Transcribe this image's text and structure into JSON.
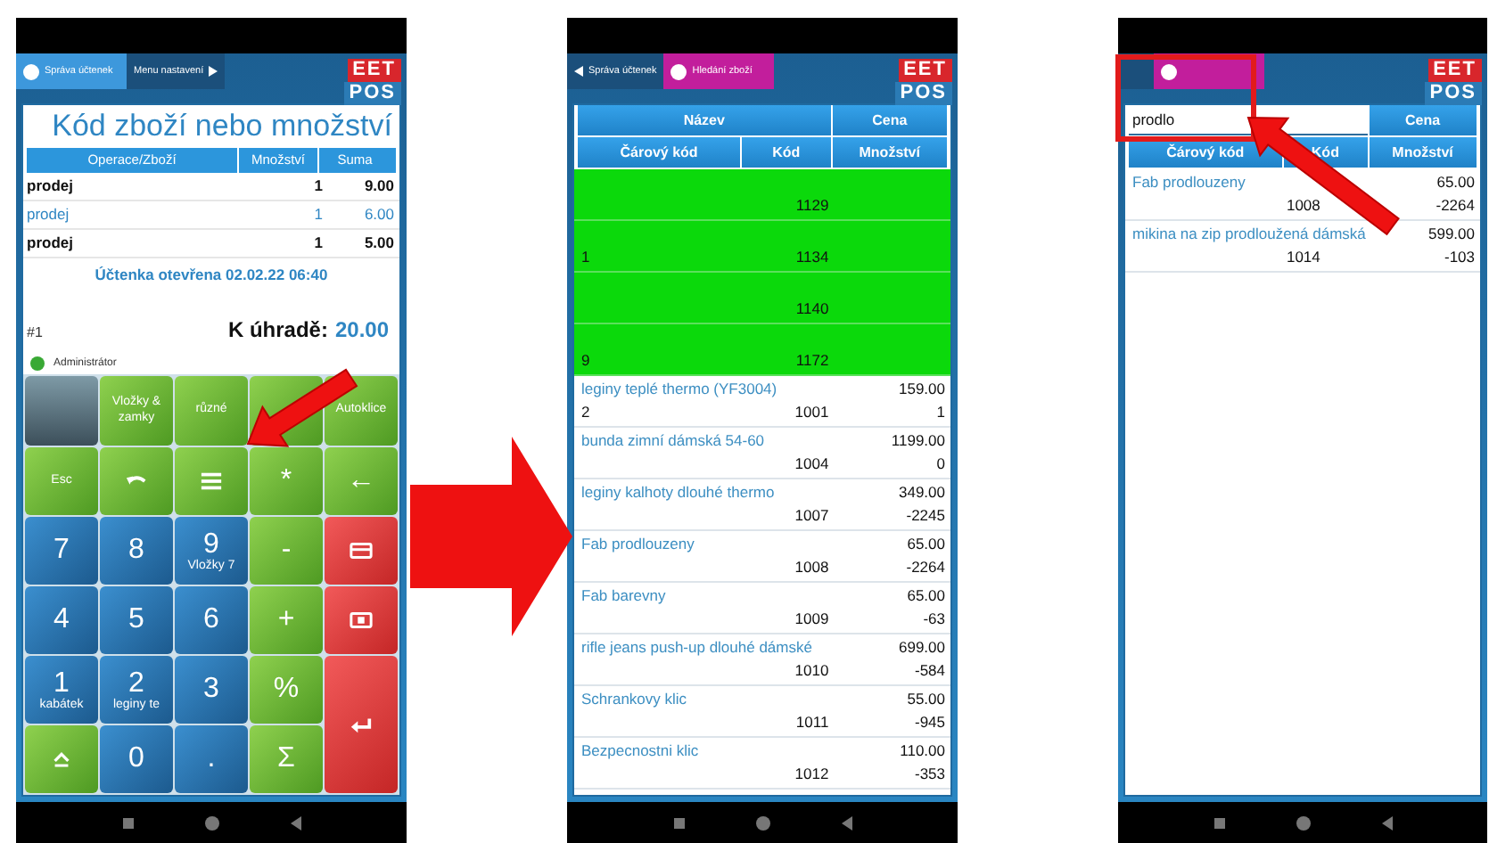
{
  "register_screen": {
    "tabs": [
      {
        "label": "Správa účtenek",
        "selected": true
      },
      {
        "label": "Menu nastavení",
        "selected": false
      }
    ],
    "logo": [
      "EET",
      "POS"
    ],
    "title": "Kód zboží nebo množství",
    "columns": [
      "Operace/Zboží",
      "Množství",
      "Suma"
    ],
    "rows": [
      {
        "operation": "prodej",
        "quantity": "1",
        "sum": "9.00",
        "selected": false
      },
      {
        "operation": "prodej",
        "quantity": "1",
        "sum": "6.00",
        "selected": true
      },
      {
        "operation": "prodej",
        "quantity": "1",
        "sum": "5.00",
        "selected": false
      }
    ],
    "receipt_opened": "Účtenka otevřena 02.02.22 06:40",
    "receipt_number": "#1",
    "due_label": "K úhradě:",
    "due_amount": "20.00",
    "user": "Administrátor",
    "keys": [
      {
        "kind": "photo"
      },
      {
        "kind": "func",
        "label": "Vložky & zamky"
      },
      {
        "kind": "func",
        "label": "různé"
      },
      {
        "kind": "func"
      },
      {
        "kind": "func",
        "label": "Autoklice"
      },
      {
        "kind": "func",
        "label": "Esc"
      },
      {
        "kind": "undo"
      },
      {
        "kind": "list"
      },
      {
        "kind": "func",
        "label": "*"
      },
      {
        "kind": "func",
        "label": "←"
      },
      {
        "kind": "digit",
        "label": "7"
      },
      {
        "kind": "digit",
        "label": "8"
      },
      {
        "kind": "digit",
        "label": "9",
        "sub": "Vložky 7"
      },
      {
        "kind": "func",
        "label": "-"
      },
      {
        "kind": "card"
      },
      {
        "kind": "digit",
        "label": "4"
      },
      {
        "kind": "digit",
        "label": "5"
      },
      {
        "kind": "digit",
        "label": "6"
      },
      {
        "kind": "func",
        "label": "+"
      },
      {
        "kind": "cash"
      },
      {
        "kind": "digit",
        "label": "1",
        "sub": "kabátek"
      },
      {
        "kind": "digit",
        "label": "2",
        "sub": "leginy te"
      },
      {
        "kind": "digit",
        "label": "3"
      },
      {
        "kind": "func",
        "label": "%"
      },
      {
        "kind": "enter"
      },
      {
        "kind": "shift"
      },
      {
        "kind": "digit",
        "label": "0"
      },
      {
        "kind": "digit",
        "label": "."
      },
      {
        "kind": "func",
        "label": "Σ"
      }
    ]
  },
  "product_list_screen": {
    "tabs": [
      {
        "label": "Správa účtenek",
        "selected": false
      },
      {
        "label": "Hledání zboží",
        "selected": true
      }
    ],
    "logo": [
      "EET",
      "POS"
    ],
    "header_top": [
      "Název",
      "Cena"
    ],
    "header_bottom": [
      "Čárový kód",
      "Kód",
      "Množství"
    ],
    "items": [
      {
        "code": "1129",
        "highlighted": true
      },
      {
        "barcode": "1",
        "code": "1134",
        "highlighted": true
      },
      {
        "code": "1140",
        "highlighted": true
      },
      {
        "barcode": "9",
        "code": "1172",
        "highlighted": true
      },
      {
        "name": "leginy teplé thermo (YF3004)",
        "price": "159.00",
        "barcode": "2",
        "code": "1001",
        "quantity": "1",
        "highlighted": false
      },
      {
        "name": "bunda zimní dámská 54-60",
        "price": "1199.00",
        "code": "1004",
        "quantity": "0",
        "highlighted": false
      },
      {
        "name": "leginy kalhoty dlouhé thermo",
        "price": "349.00",
        "code": "1007",
        "quantity": "-2245",
        "highlighted": false
      },
      {
        "name": "Fab prodlouzeny",
        "price": "65.00",
        "code": "1008",
        "quantity": "-2264",
        "highlighted": false
      },
      {
        "name": "Fab barevny",
        "price": "65.00",
        "code": "1009",
        "quantity": "-63",
        "highlighted": false
      },
      {
        "name": "rifle jeans push-up dlouhé dámské",
        "price": "699.00",
        "code": "1010",
        "quantity": "-584",
        "highlighted": false
      },
      {
        "name": "Schrankovy klic",
        "price": "55.00",
        "code": "1011",
        "quantity": "-945",
        "highlighted": false
      },
      {
        "name": "Bezpecnostni klic",
        "price": "110.00",
        "code": "1012",
        "quantity": "-353",
        "highlighted": false
      }
    ]
  },
  "search_screen": {
    "tabs": [
      {
        "selected": false
      },
      {
        "selected": true
      }
    ],
    "logo": [
      "EET",
      "POS"
    ],
    "search": {
      "value": "prodlo"
    },
    "header_top": [
      "Cena"
    ],
    "header_bottom": [
      "Čárový kód",
      "Kód",
      "Množství"
    ],
    "items": [
      {
        "name": "Fab prodlouzeny",
        "price": "65.00",
        "code": "1008",
        "quantity": "-2264",
        "highlighted": false
      },
      {
        "name": "mikina na zip prodloužená dámská",
        "price": "599.00",
        "code": "1014",
        "quantity": "-103",
        "highlighted": false
      }
    ]
  }
}
